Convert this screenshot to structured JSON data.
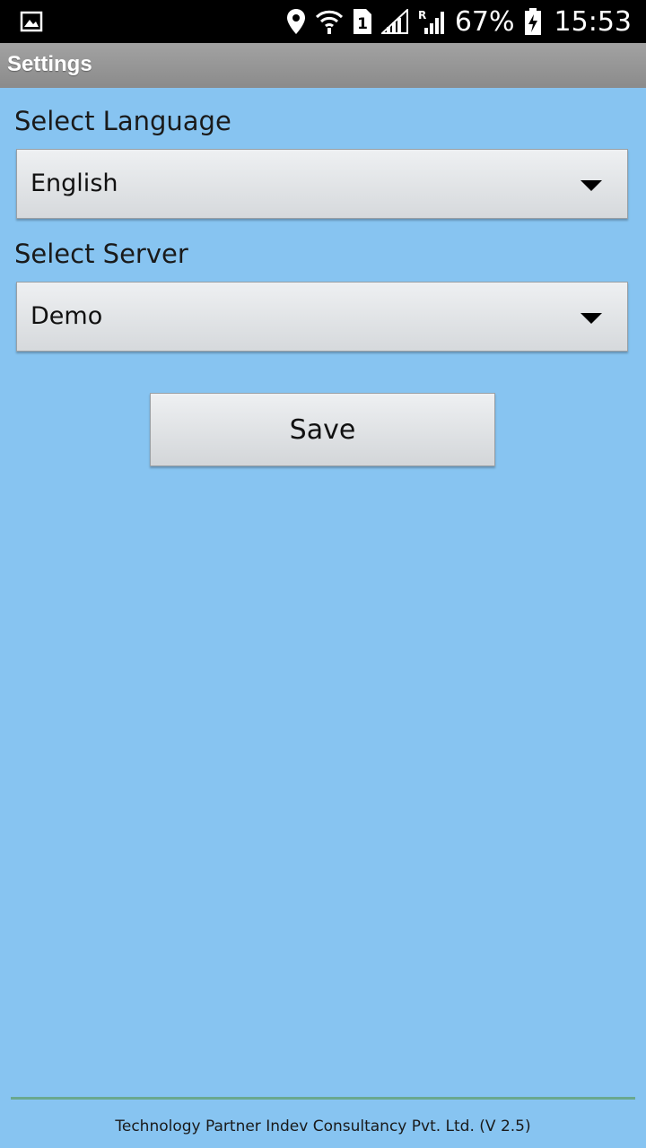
{
  "status_bar": {
    "icons": [
      "gallery-icon",
      "location-icon",
      "wifi-icon",
      "sim1-icon",
      "signal-icon",
      "roaming-signal-icon",
      "battery-charging-icon"
    ],
    "battery_percent": "67%",
    "time": "15:53"
  },
  "title_bar": {
    "title": "Settings"
  },
  "language": {
    "label": "Select Language",
    "selected": "English"
  },
  "server": {
    "label": "Select Server",
    "selected": "Demo"
  },
  "save_button": {
    "label": "Save"
  },
  "footer": {
    "text": "Technology Partner Indev Consultancy Pvt. Ltd. (V 2.5)"
  },
  "colors": {
    "background": "#87c4f1",
    "title_bar": "#969696",
    "footer_line": "#6aa88e"
  }
}
